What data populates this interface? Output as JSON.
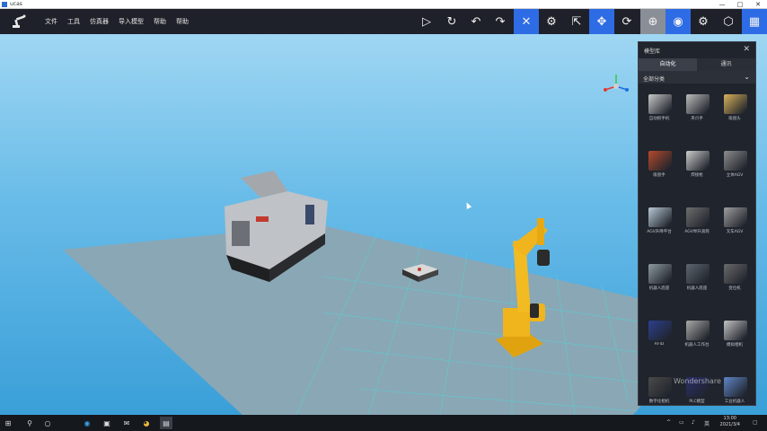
{
  "window": {
    "title": "ucas",
    "min": "—",
    "max": "□",
    "close": "✕"
  },
  "toolbar": {
    "menu": [
      "文件",
      "工具",
      "仿真器",
      "导入模型",
      "帮助",
      "帮助"
    ],
    "tools": [
      {
        "name": "play-icon",
        "glyph": "▷"
      },
      {
        "name": "refresh-icon",
        "glyph": "↻"
      },
      {
        "name": "undo-icon",
        "glyph": "↶"
      },
      {
        "name": "redo-icon",
        "glyph": "↷"
      },
      {
        "name": "collision-icon",
        "glyph": "✕"
      },
      {
        "name": "robot-icon",
        "glyph": "⚙"
      },
      {
        "name": "pointer-icon",
        "glyph": "⇱"
      },
      {
        "name": "move-icon",
        "glyph": "✥"
      },
      {
        "name": "rotate-icon",
        "glyph": "⟳"
      },
      {
        "name": "target-icon",
        "glyph": "⊕"
      },
      {
        "name": "globe-icon",
        "glyph": "◉"
      },
      {
        "name": "settings-icon",
        "glyph": "⚙"
      },
      {
        "name": "cube-icon",
        "glyph": "⬡"
      },
      {
        "name": "grid-icon",
        "glyph": "▦"
      }
    ]
  },
  "panel": {
    "title": "模型库",
    "close": "✕",
    "tabs": [
      "自动化",
      "通讯"
    ],
    "category": "全部分类",
    "items": [
      {
        "label": "自动抓手机",
        "color": "#c9c9c9"
      },
      {
        "label": "夹爪手",
        "color": "#bdbdbd"
      },
      {
        "label": "吸盘头",
        "color": "#d9b25a"
      },
      {
        "label": "吸盘手",
        "color": "#b54a2b"
      },
      {
        "label": "焊接枪",
        "color": "#cccccc"
      },
      {
        "label": "立体AGV",
        "color": "#8d8d8d"
      },
      {
        "label": "AGV升降平台",
        "color": "#b8c9d6"
      },
      {
        "label": "AGV举升滚筒",
        "color": "#6e6e6e"
      },
      {
        "label": "叉车AGV",
        "color": "#9e9e9e"
      },
      {
        "label": "机器人底座",
        "color": "#8f9aa3"
      },
      {
        "label": "机器人底座",
        "color": "#5f6670"
      },
      {
        "label": "变位机",
        "color": "#6a6a6a"
      },
      {
        "label": "RFID",
        "color": "#2c3f8f"
      },
      {
        "label": "机器人工作台",
        "color": "#a9a9a9"
      },
      {
        "label": "模拟相机",
        "color": "#c2c2c2"
      },
      {
        "label": "数字化相机",
        "color": "#4a4a4a"
      },
      {
        "label": "PLC模型",
        "color": "#2a2f6a"
      },
      {
        "label": "工业机器人",
        "color": "#5f86c7"
      }
    ]
  },
  "watermark": "Wondershare",
  "taskbar": {
    "time": "13:00",
    "date": "2021/3/4",
    "icons": [
      "windows-start-icon",
      "search-icon",
      "task-view-icon",
      "edge-icon",
      "store-icon",
      "mail-icon",
      "chrome-icon",
      "app-icon"
    ]
  },
  "colors": {
    "toolbar_bg": "#1e2129",
    "active_blue": "#2e6ce6",
    "panel_bg": "#20242c"
  }
}
